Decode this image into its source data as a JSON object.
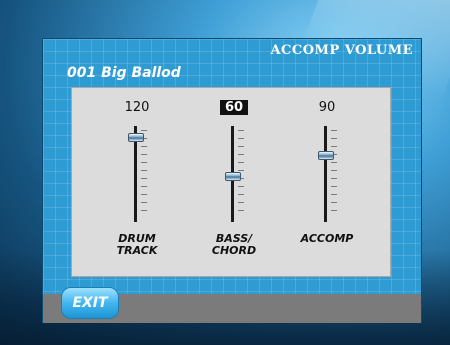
{
  "screen": {
    "title": "ACCOMP VOLUME",
    "style_name": "001 Big Ballod"
  },
  "channels": [
    {
      "value": "120",
      "label_line1": "DRUM",
      "label_line2": "TRACK",
      "level_fraction": 0.92,
      "selected": false
    },
    {
      "value": "60",
      "label_line1": "BASS/",
      "label_line2": "CHORD",
      "level_fraction": 0.47,
      "selected": true
    },
    {
      "value": "90",
      "label_line1": "ACCOMP",
      "label_line2": "",
      "level_fraction": 0.71,
      "selected": false
    }
  ],
  "footer": {
    "exit_label": "EXIT"
  },
  "colors": {
    "screen_bg": "#2f9bd3",
    "panel_bg": "#dcdcdc",
    "bottom_bar": "#7b7b7b",
    "exit_button": "#41b6ee"
  }
}
